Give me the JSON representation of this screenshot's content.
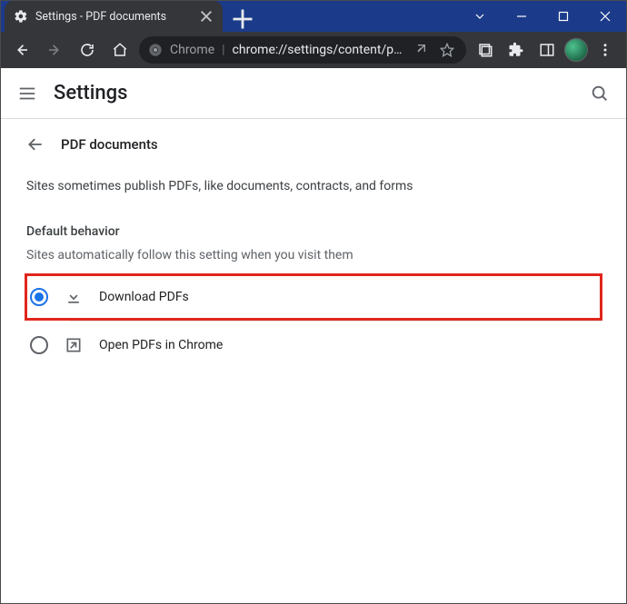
{
  "window": {
    "tab_title": "Settings - PDF documents"
  },
  "omnibox": {
    "scheme_label": "Chrome",
    "url_display": "chrome://settings/content/pdfDo…"
  },
  "header": {
    "title": "Settings"
  },
  "page": {
    "title": "PDF documents",
    "description": "Sites sometimes publish PDFs, like documents, contracts, and forms",
    "section_label": "Default behavior",
    "section_sub": "Sites automatically follow this setting when you visit them",
    "options": {
      "download": {
        "label": "Download PDFs",
        "selected": true
      },
      "open": {
        "label": "Open PDFs in Chrome",
        "selected": false
      }
    }
  }
}
